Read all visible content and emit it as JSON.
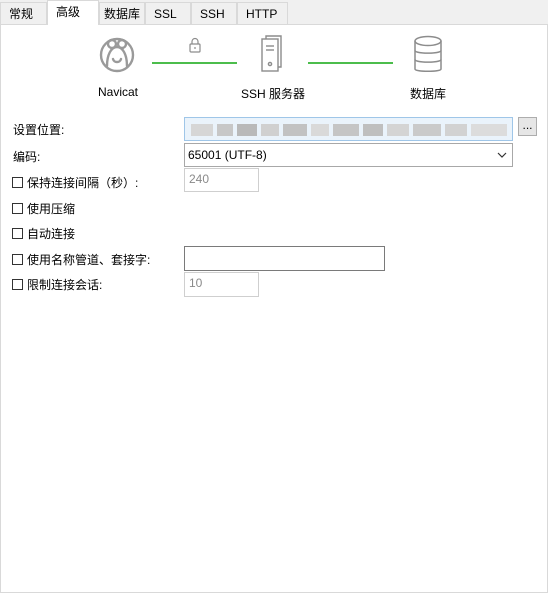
{
  "tabs": [
    {
      "label": "常规"
    },
    {
      "label": "高级"
    },
    {
      "label": "数据库"
    },
    {
      "label": "SSL"
    },
    {
      "label": "SSH"
    },
    {
      "label": "HTTP"
    }
  ],
  "active_tab": "高级",
  "diagram": {
    "client_label": "Navicat",
    "server_label": "SSH 服务器",
    "database_label": "数据库",
    "line_color": "#4cbd4c"
  },
  "form": {
    "location_label": "设置位置:",
    "browse_button_label": "...",
    "encoding_label": "编码:",
    "encoding_value": "65001 (UTF-8)",
    "keepalive_label": "保持连接间隔（秒）:",
    "keepalive_value": "240",
    "compression_label": "使用压缩",
    "autoconnect_label": "自动连接",
    "named_pipe_label": "使用名称管道、套接字:",
    "named_pipe_value": "",
    "limit_sessions_label": "限制连接会话:",
    "limit_sessions_value": "10"
  }
}
